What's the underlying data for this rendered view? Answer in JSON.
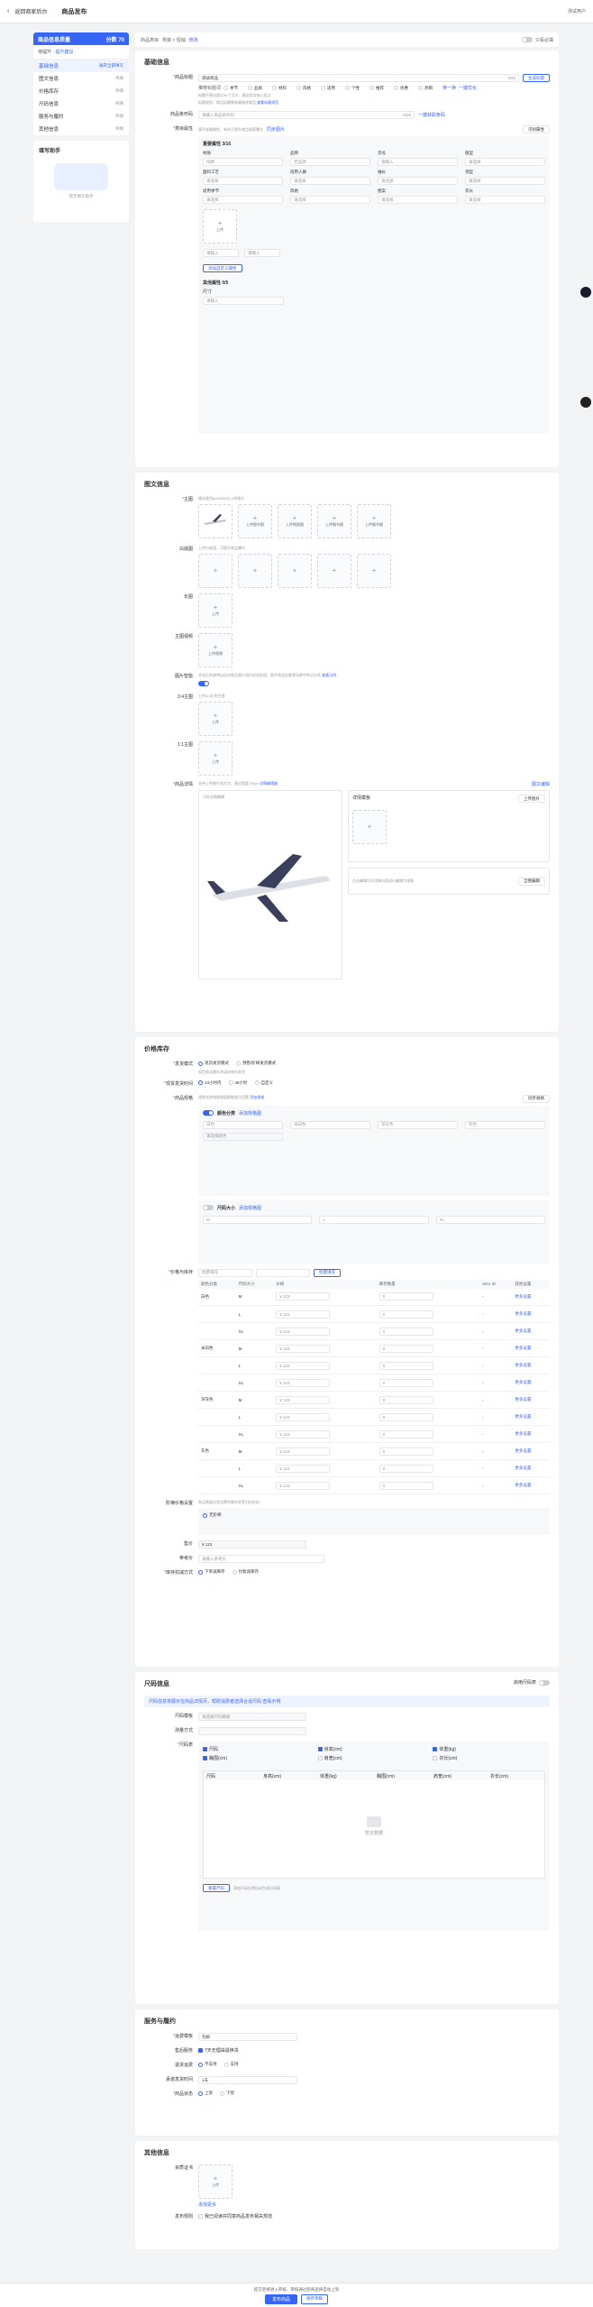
{
  "topbar": {
    "back": "返回商家后台",
    "title": "商品发布",
    "user": "测试用户"
  },
  "sidebar": {
    "header": "商品信息质量",
    "score": "分数 70",
    "level": "待提升",
    "level_tip": "提升建议",
    "items": [
      {
        "label": "基础信息",
        "status": "展开全部填写"
      },
      {
        "label": "图文信息",
        "status": "待填"
      },
      {
        "label": "价格库存",
        "status": "待填"
      },
      {
        "label": "尺码信息",
        "status": "待填"
      },
      {
        "label": "服务与履约",
        "status": "待填"
      },
      {
        "label": "其他信息",
        "status": "待填"
      }
    ],
    "help_title": "填写助手",
    "help_caption": "暂无填写助手"
  },
  "crumb": {
    "label": "商品类目",
    "path": "男装 > 短袖",
    "edit": "修改",
    "toggle": "只看必填"
  },
  "basic": {
    "title": "基础信息",
    "name_label": "商品标题",
    "name_value": "测试商品",
    "name_count": "4/60",
    "gen_btn": "生成标题",
    "tags": [
      "季节",
      "品质",
      "材料",
      "风格",
      "适用",
      "个性",
      "推荐",
      "优惠",
      "热销"
    ],
    "tag_label": "推荐标题词",
    "tag_more": "换一换",
    "tag_search": "一键优化",
    "name_hint": "标题不建议超过30个汉字，建议包含核心卖点",
    "name_hint2": "标题规则：商品标题需准确描述商品",
    "name_link": "查看标题规范",
    "barcode_label": "商品条形码",
    "barcode_ph": "请输入商品条形码",
    "barcode_count": "0/38",
    "barcode_link": "一键获取条码",
    "attr_label": "类目属性",
    "attr_hint": "填写准确属性，有利于提升商品搜索曝光",
    "attr_link": "同步图片",
    "attr_btn": "识别属性",
    "attr_title": "重要属性 3/16",
    "attr_fields": [
      {
        "l": "品牌",
        "v": "无品牌"
      },
      {
        "l": "货号",
        "v": "请输入"
      },
      {
        "l": "版型",
        "v": "请选择"
      },
      {
        "l": "面料工艺",
        "v": "请选择"
      },
      {
        "l": "适用人群",
        "v": "请选择"
      },
      {
        "l": "袖长",
        "v": "请选择"
      },
      {
        "l": "领型",
        "v": "请选择"
      },
      {
        "l": "适用季节",
        "v": "请选择"
      },
      {
        "l": "风格",
        "v": "请选择"
      },
      {
        "l": "图案",
        "v": "请选择"
      },
      {
        "l": "衣长",
        "v": "请选择"
      }
    ],
    "attr_first": {
      "l": "材质",
      "v": "纯棉"
    },
    "add_attr": "添加自定义属性",
    "other_title": "其他属性 0/5",
    "other_l": "尺寸",
    "other_v": "请输入"
  },
  "media": {
    "title": "图文信息",
    "main_label": "主图",
    "main_hint": "建议使用800x800以上的图片",
    "upload_labels": [
      "上传细节图",
      "上传侧面图",
      "上传细节图",
      "上传细节图"
    ],
    "white_label": "白底图",
    "white_hint": "上传白底图，可提升商品曝光",
    "long_label": "长图",
    "video_label": "主图视频",
    "video_hint": "视频时长不超过60秒",
    "video_btn": "上传视频",
    "smart_label": "图片智能",
    "smart_hint": "开启后系统将自动对商品图片进行优化处理，提升商品在推荐场景中的点击率",
    "smart_link": "查看示例",
    "size34_label": "3:4主图",
    "size34_hint": "上传3:4比例主图",
    "size11_label": "1:1主图",
    "detail_label": "商品详情",
    "detail_hint": "支持上传图片和文字，建议宽度750px",
    "detail_link": "详情编辑器",
    "detail_tab": "图文编辑",
    "edit_tip": "可在右侧编辑",
    "detail_btn": "上传图片",
    "detail_btn2": "全图编辑",
    "detail_right_title": "详情模板",
    "detail_right_hint": "点击编辑可对详情内容进行编辑与排版"
  },
  "price": {
    "title": "价格库存",
    "mode_label": "发货模式",
    "mode_opts": [
      "现货发货模式",
      "预售/阶梯发货模式"
    ],
    "mode_hint": "现货商品需在承诺时效内发货",
    "ship_label": "现货发货时间",
    "ship_opts": [
      "24小时内",
      "48小时",
      "自定义"
    ],
    "spec_label": "商品规格",
    "spec_hint": "规格名称和规格值根据类目设置",
    "spec_link": "添加规格",
    "spec_btn": "同步规格",
    "color_title": "颜色分类",
    "color_sub": "添加规格图",
    "color_vals": [
      "白色",
      "米白色",
      "深灰色",
      "灰色"
    ],
    "color_opts": [
      "请选择颜色"
    ],
    "size_title": "尺码大小",
    "size_sub": "添加规格图",
    "size_vals": [
      "M",
      "L",
      "XL"
    ],
    "table_label": "价格与库存",
    "batch_ph": "批量填充",
    "batch_btn": "批量填充",
    "headers": [
      "颜色分类",
      "尺码大小",
      "价格",
      "库存数量",
      "SKU ID",
      "其他设置"
    ],
    "rows": [
      {
        "c": "白色",
        "s": "M",
        "p": "¥ 123",
        "q": "0"
      },
      {
        "c": "",
        "s": "L",
        "p": "¥ 123",
        "q": "0"
      },
      {
        "c": "",
        "s": "XL",
        "p": "¥ 123",
        "q": "0"
      },
      {
        "c": "米白色",
        "s": "M",
        "p": "¥ 123",
        "q": "0"
      },
      {
        "c": "",
        "s": "L",
        "p": "¥ 123",
        "q": "0"
      },
      {
        "c": "",
        "s": "XL",
        "p": "¥ 123",
        "q": "0"
      },
      {
        "c": "深灰色",
        "s": "M",
        "p": "¥ 123",
        "q": "0"
      },
      {
        "c": "",
        "s": "L",
        "p": "¥ 123",
        "q": "0"
      },
      {
        "c": "",
        "s": "XL",
        "p": "¥ 123",
        "q": "0"
      },
      {
        "c": "灰色",
        "s": "M",
        "p": "¥ 123",
        "q": "0"
      },
      {
        "c": "",
        "s": "L",
        "p": "¥ 123",
        "q": "0"
      },
      {
        "c": "",
        "s": "XL",
        "p": "¥ 123",
        "q": "0"
      }
    ],
    "row_more": "更多设置",
    "sku_dash": "-",
    "group_label": "阶梯价格设置",
    "group_hint": "购买数量达到设置件数时享受对应折扣",
    "group_opt": "无阶梯",
    "price_label": "售价",
    "price_value": "¥ 123",
    "ref_label": "参考价",
    "ref_ph": "请输入参考价",
    "stock_label": "库存扣减方式",
    "stock_opts": [
      "下单减库存",
      "付款减库存"
    ]
  },
  "sizeinfo": {
    "title": "尺码信息",
    "toggle": "启用尺码表",
    "tip": "尺码信息将展示在商品详情页，帮助消费者选择合适尺码",
    "tip_link": "查看示例",
    "tmpl_label": "尺码模板",
    "tmpl_ph": "请选择尺码模板",
    "table_label": "尺码表",
    "measure_label": "测量方式",
    "cols": [
      "尺码",
      "身高(cm)",
      "体重(kg)",
      "胸围(cm)",
      "肩宽(cm)",
      "衣长(cm)"
    ],
    "empty": "暂无数据",
    "reset": "重置尺码",
    "gen_hint": "添加尺码后将自动生成尺码表"
  },
  "service": {
    "title": "服务与履约",
    "ship_label": "运费模板",
    "ship_v": "包邮",
    "express_label": "售后服务",
    "express_opt": "7天无理由退换货",
    "return_label": "退货运费",
    "ret_opts": [
      "不支持",
      "支持"
    ],
    "promise_label": "承诺发货时间",
    "promise_v": "1天",
    "quality_label": "商品状态",
    "q_opts": [
      "上架",
      "下架"
    ]
  },
  "other": {
    "title": "其他信息",
    "cert_label": "资质证书",
    "cert_btn": "上传",
    "link": "添加更多",
    "agree_label": "发布规则",
    "agree": "我已阅读并同意商品发布相关规范"
  },
  "footer": {
    "tip": "提交后将进入审核，审核通过后商品将自动上架",
    "publish": "发布商品",
    "draft": "保存草稿"
  }
}
